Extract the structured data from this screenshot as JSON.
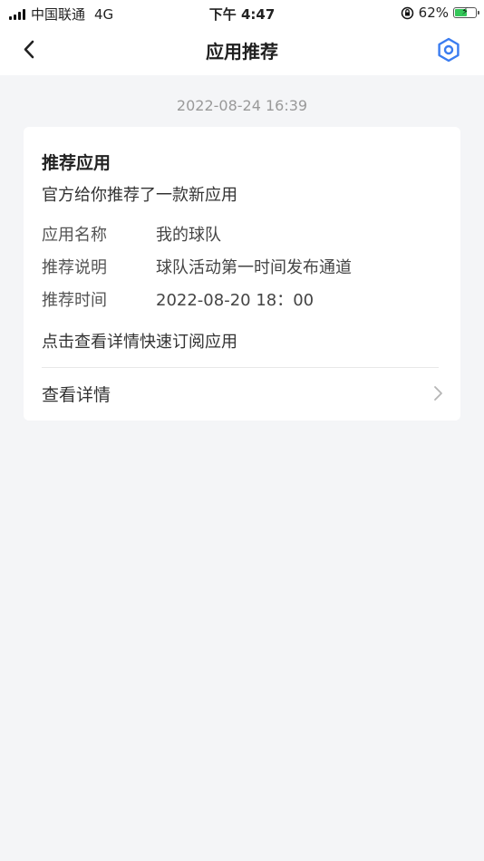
{
  "status_bar": {
    "carrier": "中国联通",
    "network": "4G",
    "time": "下午 4:47",
    "battery_percent": "62%",
    "battery_level": 0.62,
    "battery_color": "#34c759",
    "icons": [
      "signal-icon",
      "orientation-lock-icon",
      "battery-icon",
      "charging-bolt-icon"
    ]
  },
  "nav": {
    "title": "应用推荐",
    "back_icon": "chevron-left-icon",
    "settings_icon": "hexagon-settings-icon",
    "accent_color": "#3a7cf0"
  },
  "message": {
    "timestamp": "2022-08-24 16:39",
    "card": {
      "title": "推荐应用",
      "subtitle": "官方给你推荐了一款新应用",
      "details": [
        {
          "label": "应用名称",
          "value": "我的球队"
        },
        {
          "label": "推荐说明",
          "value": "球队活动第一时间发布通道"
        },
        {
          "label": "推荐时间",
          "value": "2022-08-20 18：00"
        }
      ],
      "hint": "点击查看详情快速订阅应用",
      "action_label": "查看详情",
      "action_icon": "chevron-right-icon"
    }
  }
}
